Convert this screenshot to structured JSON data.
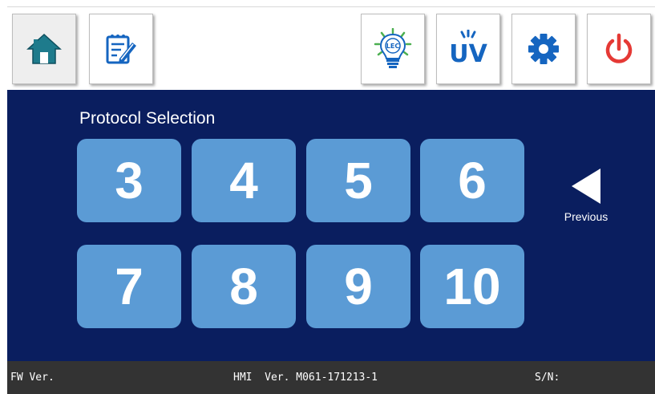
{
  "toolbar": {
    "buttons": [
      {
        "icon": "home-icon",
        "active": true
      },
      {
        "icon": "notepad-edit-icon",
        "active": false
      },
      {
        "icon": "lec-lightbulb-icon",
        "label": "LEC"
      },
      {
        "icon": "uv-icon",
        "label": "UV"
      },
      {
        "icon": "gear-icon"
      },
      {
        "icon": "power-icon"
      }
    ]
  },
  "main": {
    "title": "Protocol Selection",
    "protocols": [
      "3",
      "4",
      "5",
      "6",
      "7",
      "8",
      "9",
      "10"
    ],
    "previous_label": "Previous"
  },
  "status_bar": {
    "fw": "FW Ver.",
    "hmi": "HMI  Ver. M061-171213-1",
    "sn": "S/N:"
  },
  "colors": {
    "panel_bg": "#0a1e5f",
    "protocol_button": "#5b9bd5",
    "accent_blue": "#1565c0",
    "power_red": "#e53935",
    "home_teal": "#1e7b8c",
    "status_bg": "#333333"
  }
}
